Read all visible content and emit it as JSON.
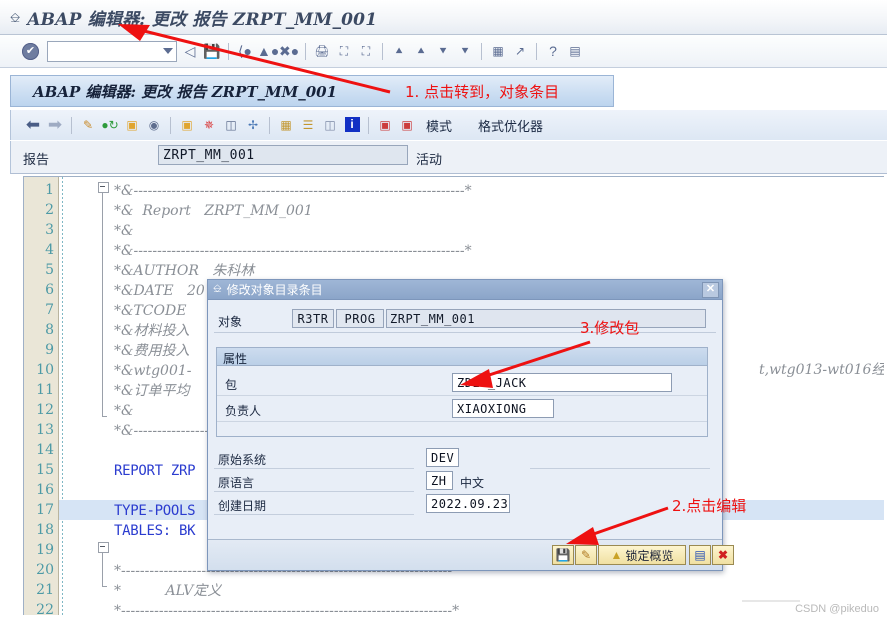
{
  "window": {
    "icon": "window-doc-icon",
    "title": "ABAP 编辑器: 更改 报告 ZRPT_MM_001"
  },
  "main_toolbar": {
    "check_icon": "check-circle-icon",
    "command_field_value": "",
    "command_field_placeholder": "",
    "icons": [
      "back-arrow-icon",
      "save-icon",
      "back-green-icon",
      "exit-up-icon",
      "cancel-x-icon",
      "print-icon",
      "find-icon",
      "find-next-icon",
      "first-page-icon",
      "previous-page-icon",
      "next-page-icon",
      "last-page-icon",
      "new-session-icon",
      "create-shortcut-icon",
      "help-icon",
      "layout-menu-icon"
    ]
  },
  "screen_band": {
    "title": "ABAP 编辑器: 更改 报告 ZRPT_MM_001"
  },
  "app_toolbar": {
    "icons": [
      "back-left-arrow-icon",
      "forward-right-arrow-icon",
      "check-syntax-pencil-icon",
      "activate-icon",
      "copy-object-icon",
      "pattern-icon",
      "pretty-printer-icon",
      "insert-statement-icon",
      "display-navigation-icon",
      "expand-icon",
      "structure-icon",
      "outline-icon",
      "list-icon",
      "info-icon",
      "debug-icon",
      "debug-user-icon"
    ],
    "labels": [
      "模式",
      "格式优化器"
    ]
  },
  "report_row": {
    "label": "报告",
    "value": "ZRPT_MM_001",
    "status": "活动"
  },
  "editor": {
    "lines": [
      {
        "n": "1",
        "text": "*&----------------------------------------------------------------------*",
        "type": "comment",
        "fold": "start"
      },
      {
        "n": "2",
        "text": "*&  Report   ZRPT_MM_001",
        "type": "comment"
      },
      {
        "n": "3",
        "text": "*&",
        "type": "comment"
      },
      {
        "n": "4",
        "text": "*&----------------------------------------------------------------------*",
        "type": "comment"
      },
      {
        "n": "5",
        "text": "*&AUTHOR   朱科林",
        "type": "comment"
      },
      {
        "n": "6",
        "text": "*&DATE   20",
        "type": "comment"
      },
      {
        "n": "7",
        "text": "*&TCODE",
        "type": "comment"
      },
      {
        "n": "8",
        "text": "*&材料投入",
        "type": "comment"
      },
      {
        "n": "9",
        "text": "*&费用投入",
        "type": "comment"
      },
      {
        "n": "10",
        "text": "*&wtg001-",
        "type": "comment",
        "tail": "t,wtg013-wt016经"
      },
      {
        "n": "11",
        "text": "*&订单平均",
        "type": "comment"
      },
      {
        "n": "12",
        "text": "*&",
        "type": "comment"
      },
      {
        "n": "13",
        "text": "*&----------------------------------------------------------------------*",
        "type": "comment",
        "fold": "end"
      },
      {
        "n": "14",
        "text": "",
        "type": "comment"
      },
      {
        "n": "15",
        "text": "REPORT ZRP",
        "type": "keyword"
      },
      {
        "n": "16",
        "text": "",
        "type": "comment"
      },
      {
        "n": "17",
        "text": "TYPE-POOLS",
        "type": "keyword",
        "selected": true
      },
      {
        "n": "18",
        "text": "TABLES: BK",
        "type": "keyword"
      },
      {
        "n": "19",
        "text": "",
        "type": "comment"
      },
      {
        "n": "20",
        "text": "*----------------------------------------------------------------------*",
        "type": "comment",
        "fold": "start"
      },
      {
        "n": "21",
        "text": "*          ALV定义",
        "type": "comment"
      },
      {
        "n": "22",
        "text": "*----------------------------------------------------------------------*",
        "type": "comment",
        "fold": "end"
      }
    ]
  },
  "dialog": {
    "icon": "dialog-doc-icon",
    "title": "修改对象目录条目",
    "close_label": "✕",
    "object": {
      "label": "对象",
      "type_field": "R3TR",
      "subtype_field": "PROG",
      "name_field": "ZRPT_MM_001"
    },
    "attributes": {
      "group_title": "属性",
      "package": {
        "label": "包",
        "value": "ZDEV_JACK"
      },
      "person_responsible": {
        "label": "负责人",
        "value": "XIAOXIONG"
      }
    },
    "origin": {
      "original_system": {
        "label": "原始系统",
        "value": "DEV"
      },
      "original_language": {
        "label": "原语言",
        "value": "ZH",
        "extra": "中文"
      },
      "created_on": {
        "label": "创建日期",
        "value": "2022.09.23"
      }
    },
    "footer_buttons": [
      {
        "name": "save-button",
        "icon": "floppy-save-icon",
        "label": ""
      },
      {
        "name": "edit-button",
        "icon": "pencil-edit-icon",
        "label": ""
      },
      {
        "name": "lock-overview-button",
        "icon": "person-lock-icon",
        "label": "锁定概览"
      },
      {
        "name": "local-object-button",
        "icon": "local-object-icon",
        "label": ""
      },
      {
        "name": "cancel-button",
        "icon": "red-x-icon",
        "label": ""
      }
    ]
  },
  "annotations": [
    {
      "id": "a1",
      "text": "1. 点击转到，对象条目"
    },
    {
      "id": "a2",
      "text": "2.点击编辑"
    },
    {
      "id": "a3",
      "text": "3.修改包"
    }
  ],
  "watermark": "CSDN @pikeduo",
  "colors": {
    "annotation_red": "#ee1111",
    "band_blue": "#bcd4ee",
    "keyword_blue": "#2b3ccf",
    "comment_gray": "#8a8f96",
    "linenum_teal": "#4d9aa6",
    "gutter_beige": "#eae6d7"
  }
}
